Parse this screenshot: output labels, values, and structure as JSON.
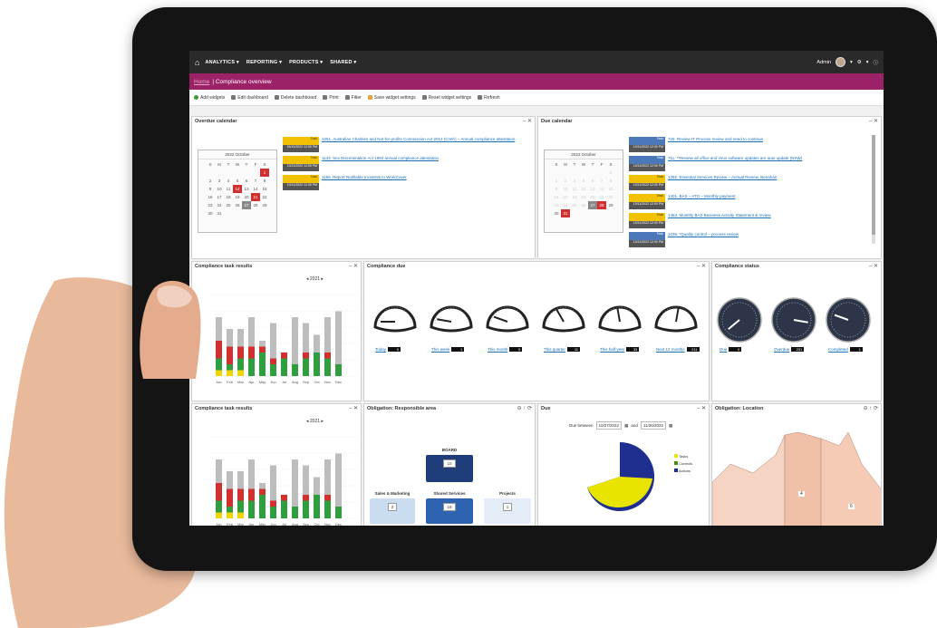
{
  "nav": {
    "menus": [
      "ANALYTICS ▾",
      "REPORTING ▾",
      "PRODUCTS ▾",
      "SHARED ▾"
    ],
    "user": "Admin"
  },
  "title": {
    "crumb": "Home",
    "text": "| Compliance overview"
  },
  "toolbar": [
    "Add widgets",
    "Edit dashboard",
    "Delete dashboard",
    "Print",
    "Filter",
    "Save widget settings",
    "Reset widget settings",
    "Refresh"
  ],
  "widgets": {
    "overdue_calendar": {
      "title": "Overdue calendar",
      "month": "2022 October",
      "tasks": [
        {
          "tag": "Task",
          "date": "16/10/2022 12:00 PM",
          "text": "1251. Australian Charities and Not-for-profits Commission Act 2012 (Cmth) – Annual compliance attestation"
        },
        {
          "tag": "Task",
          "date": "10/11/2022 12:00 PM",
          "text": "1143. Sex Discrimination Act 1984 annual compliance attestation"
        },
        {
          "tag": "Task",
          "date": "10/11/2022 12:00 PM",
          "text": "1155. Report Notifiable Incidents to WorkCover"
        }
      ]
    },
    "due_calendar": {
      "title": "Due calendar",
      "month": "2022 October",
      "tasks": [
        {
          "tag": "Task",
          "date": "10/11/2022 12:00 PM",
          "text": "726. Review IT Process review and need to continue",
          "color": "blue"
        },
        {
          "tag": "Task",
          "date": "10/11/2022 12:00 PM",
          "text": "711. **Review all office and virus software updates are auto update (NSW)",
          "color": "blue"
        },
        {
          "tag": "Task",
          "date": "10/11/2022 12:00 PM",
          "text": "1392. Essential Services Review – Annual Review, Benahan",
          "color": "yellow"
        },
        {
          "tag": "Task",
          "date": "10/11/2022 12:00 PM",
          "text": "1401. BAS – ATO – Monthly payment",
          "color": "yellow"
        },
        {
          "tag": "Task",
          "date": "10/11/2022 12:00 PM",
          "text": "1463. Monthly BAS Business Activity Statement & review",
          "color": "yellow"
        },
        {
          "tag": "Task",
          "date": "10/11/2022 12:00 PM",
          "text": "1035. *Quality control – process review",
          "color": "blue"
        }
      ]
    },
    "task_results_1": {
      "title": "Compliance task results",
      "year": "2021"
    },
    "task_results_2": {
      "title": "Compliance task results",
      "year": "2021"
    },
    "compliance_due": {
      "title": "Compliance due",
      "gauges": [
        {
          "label": "Today",
          "value": "0"
        },
        {
          "label": "This week",
          "value": "1"
        },
        {
          "label": "This month",
          "value": "5"
        },
        {
          "label": "This quarter",
          "value": "11"
        },
        {
          "label": "This half-year",
          "value": "33"
        },
        {
          "label": "Next 12 months",
          "value": "211"
        }
      ]
    },
    "compliance_status": {
      "title": "Compliance status",
      "gauges": [
        {
          "label": "Due",
          "value": "0"
        },
        {
          "label": "Overdue",
          "value": "231"
        },
        {
          "label": "Completed",
          "value": "1"
        }
      ]
    },
    "responsible_area": {
      "title": "Obligation: Responsible area",
      "nodes": [
        {
          "label": "BOARD",
          "count": "10"
        },
        {
          "label": "Sales & Marketing",
          "count": "2"
        },
        {
          "label": "Shared Services",
          "count": "18"
        },
        {
          "label": "Projects",
          "count": "1"
        }
      ]
    },
    "due": {
      "title": "Due",
      "from_label": "Due between",
      "from": "10/27/2022",
      "and": "and",
      "to": "11/26/2022",
      "legend": [
        "Tasks",
        "Controls",
        "Actions"
      ]
    },
    "location": {
      "title": "Obligation: Location",
      "labels": [
        "4",
        "6"
      ]
    }
  },
  "months": [
    "Jan",
    "Feb",
    "Mar",
    "Apr",
    "May",
    "Jun",
    "Jul",
    "Aug",
    "Sep",
    "Oct",
    "Nov",
    "Dec"
  ],
  "colors": {
    "accent": "#9b2266",
    "red": "#d32f2f",
    "green": "#2e9e3e",
    "yellow": "#f2d400",
    "gray": "#bdbdbd"
  }
}
